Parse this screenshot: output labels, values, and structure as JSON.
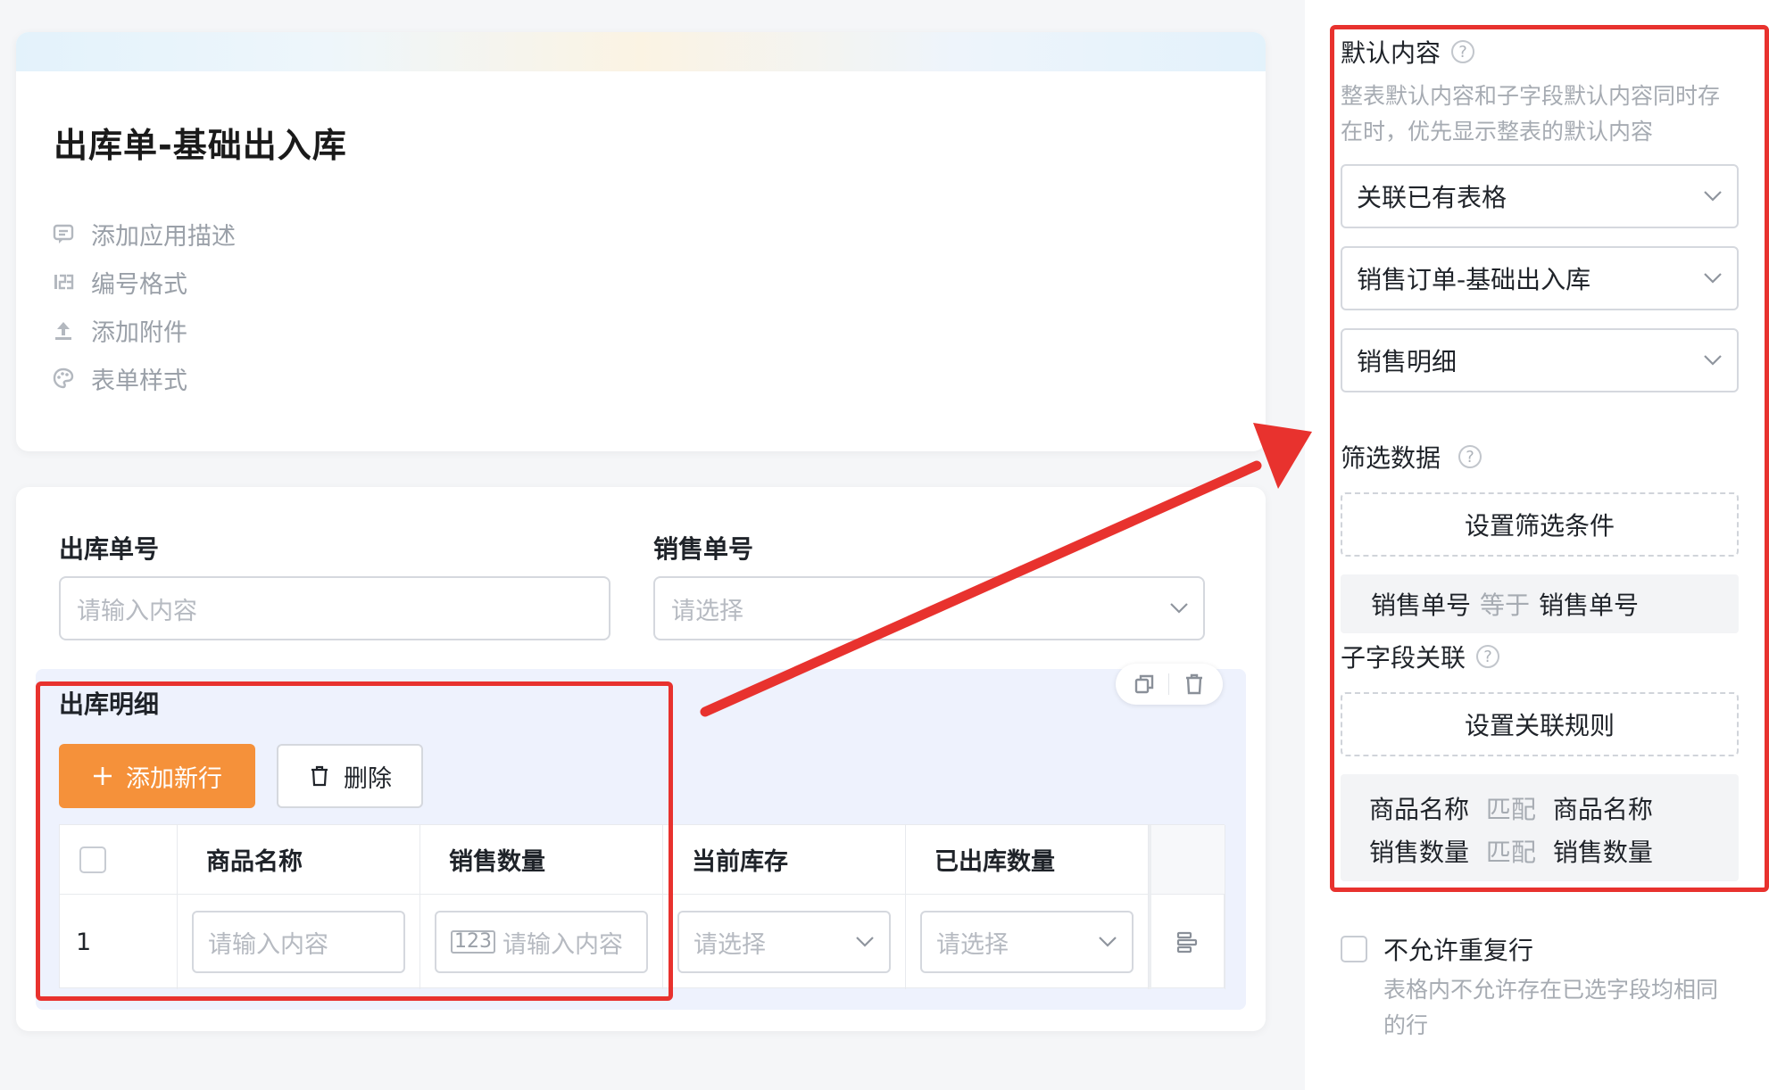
{
  "app": {
    "title": "出库单-基础出入库",
    "meta_items": [
      "添加应用描述",
      "编号格式",
      "添加附件",
      "表单样式"
    ]
  },
  "form": {
    "field1": {
      "label": "出库单号",
      "placeholder": "请输入内容"
    },
    "field2": {
      "label": "销售单号",
      "placeholder": "请选择"
    }
  },
  "subform": {
    "title": "出库明细",
    "add_button": "添加新行",
    "delete_button": "删除",
    "columns": [
      "商品名称",
      "销售数量",
      "当前库存",
      "已出库数量"
    ],
    "row": {
      "index": "1",
      "cells": [
        "请输入内容",
        "请输入内容",
        "请选择",
        "请选择"
      ]
    }
  },
  "panel": {
    "default_content": {
      "title": "默认内容",
      "desc_line1": "整表默认内容和子字段默认内容同时存",
      "desc_line2": "在时，优先显示整表的默认内容",
      "selects": [
        "关联已有表格",
        "销售订单-基础出入库",
        "销售明细"
      ]
    },
    "filter": {
      "title": "筛选数据",
      "button": "设置筛选条件",
      "rule": {
        "left": "销售单号",
        "op": "等于",
        "right": "销售单号"
      }
    },
    "sub_link": {
      "title": "子字段关联",
      "button": "设置关联规则",
      "rules": [
        {
          "left": "商品名称",
          "op": "匹配",
          "right": "商品名称"
        },
        {
          "left": "销售数量",
          "op": "匹配",
          "right": "销售数量"
        }
      ]
    },
    "no_dup": {
      "label": "不允许重复行",
      "desc_line1": "表格内不允许存在已选字段均相同",
      "desc_line2": "的行"
    }
  },
  "colors": {
    "accent_orange": "#f5913a",
    "annotation_red": "#e8322e"
  }
}
